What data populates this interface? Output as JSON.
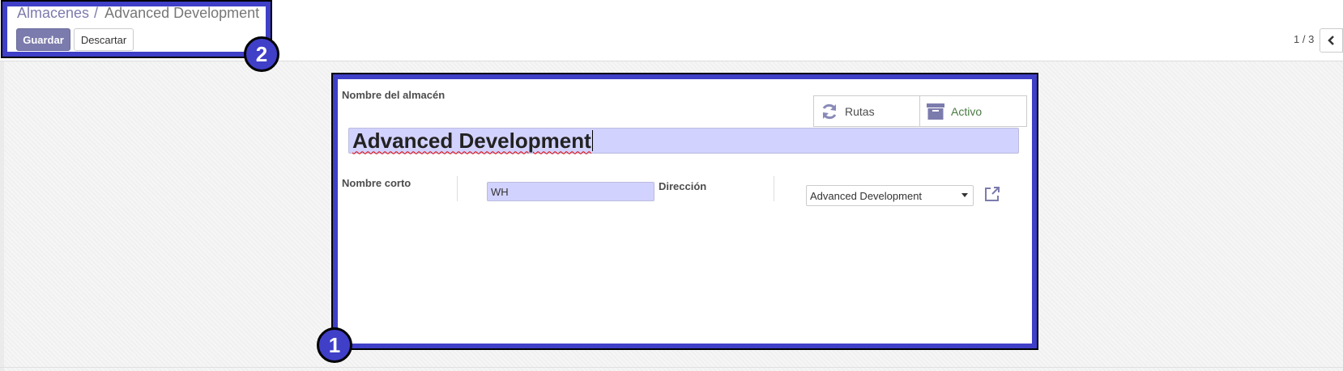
{
  "breadcrumb": {
    "parent": "Almacenes",
    "separator": "/",
    "current": "Advanced Development"
  },
  "toolbar": {
    "save_label": "Guardar",
    "discard_label": "Descartar"
  },
  "pager": {
    "value": "1 / 3",
    "prev_icon": "chevron-left-icon"
  },
  "form": {
    "warehouse_name_label": "Nombre del almacén",
    "warehouse_name_value": "Advanced Development",
    "short_name_label": "Nombre corto",
    "short_name_value": "WH",
    "address_label": "Dirección",
    "address_value": "Advanced Development",
    "smart_buttons": [
      {
        "label": "Rutas",
        "icon": "refresh-icon"
      },
      {
        "label": "Activo",
        "icon": "archive-icon"
      }
    ]
  },
  "annotations": {
    "badge_1": "1",
    "badge_2": "2"
  },
  "colors": {
    "primary": "#7c7bad",
    "highlight": "#3f3fc8",
    "field_bg": "#d2d2ff",
    "active_text": "#4a7a43"
  }
}
